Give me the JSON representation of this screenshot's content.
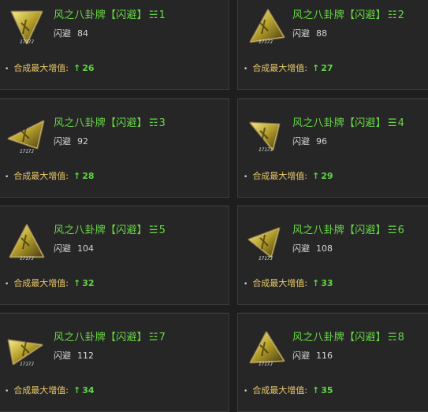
{
  "items": [
    {
      "name": "风之八卦牌【闪避】",
      "trigram": "☵",
      "number": "1",
      "stat_label": "闪避",
      "stat_value": "84",
      "bonus_label": "合成最大增值:",
      "bonus_arrow": "↑",
      "bonus_value": "26",
      "icon": "triangle-token-icon",
      "stamp": "1717J"
    },
    {
      "name": "风之八卦牌【闪避】",
      "trigram": "☷",
      "number": "2",
      "stat_label": "闪避",
      "stat_value": "88",
      "bonus_label": "合成最大增值:",
      "bonus_arrow": "↑",
      "bonus_value": "27",
      "icon": "triangle-token-icon",
      "stamp": "1717J"
    },
    {
      "name": "风之八卦牌【闪避】",
      "trigram": "☶",
      "number": "3",
      "stat_label": "闪避",
      "stat_value": "92",
      "bonus_label": "合成最大增值:",
      "bonus_arrow": "↑",
      "bonus_value": "28",
      "icon": "triangle-token-icon",
      "stamp": "1717J"
    },
    {
      "name": "风之八卦牌【闪避】",
      "trigram": "☰",
      "number": "4",
      "stat_label": "闪避",
      "stat_value": "96",
      "bonus_label": "合成最大增值:",
      "bonus_arrow": "↑",
      "bonus_value": "29",
      "icon": "triangle-token-icon",
      "stamp": "1717J"
    },
    {
      "name": "风之八卦牌【闪避】",
      "trigram": "☱",
      "number": "5",
      "stat_label": "闪避",
      "stat_value": "104",
      "bonus_label": "合成最大增值:",
      "bonus_arrow": "↑",
      "bonus_value": "32",
      "icon": "triangle-token-icon",
      "stamp": "1717J"
    },
    {
      "name": "风之八卦牌【闪避】",
      "trigram": "☲",
      "number": "6",
      "stat_label": "闪避",
      "stat_value": "108",
      "bonus_label": "合成最大增值:",
      "bonus_arrow": "↑",
      "bonus_value": "33",
      "icon": "triangle-token-icon",
      "stamp": "1717J"
    },
    {
      "name": "风之八卦牌【闪避】",
      "trigram": "☳",
      "number": "7",
      "stat_label": "闪避",
      "stat_value": "112",
      "bonus_label": "合成最大增值:",
      "bonus_arrow": "↑",
      "bonus_value": "34",
      "icon": "triangle-token-icon",
      "stamp": "1717J"
    },
    {
      "name": "风之八卦牌【闪避】",
      "trigram": "☴",
      "number": "8",
      "stat_label": "闪避",
      "stat_value": "116",
      "bonus_label": "合成最大增值:",
      "bonus_arrow": "↑",
      "bonus_value": "35",
      "icon": "triangle-token-icon",
      "stamp": "1717J"
    }
  ],
  "colors": {
    "name_green": "#67d845",
    "bonus_gold": "#e8c86a",
    "bonus_value_green": "#5ed642",
    "card_bg": "#262626",
    "page_bg": "#1e1e1e"
  }
}
